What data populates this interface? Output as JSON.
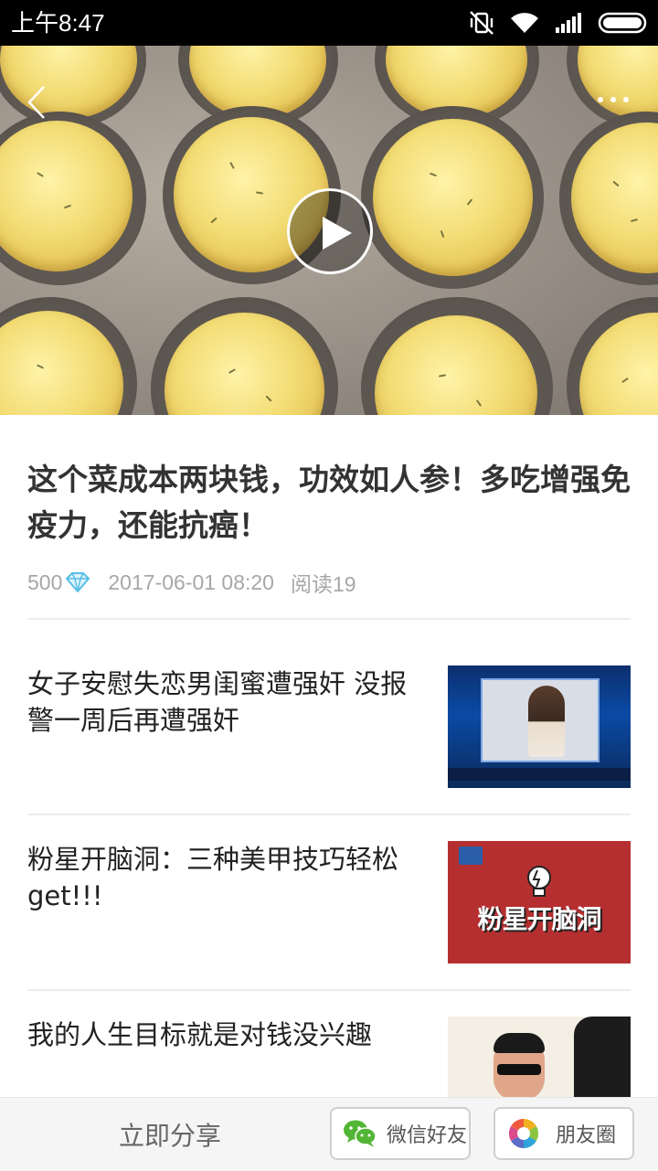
{
  "status_bar": {
    "time": "上午8:47"
  },
  "video": {
    "accent_color": "#ffffff"
  },
  "article": {
    "title": "这个菜成本两块钱，功效如人参！多吃增强免疫力，还能抗癌！",
    "coins": "500",
    "date": "2017-06-01 08:20",
    "reads": "阅读19"
  },
  "related": [
    {
      "title": "女子安慰失恋男闺蜜遭强奸 没报警一周后再遭强奸"
    },
    {
      "title": "粉星开脑洞：三种美甲技巧轻松get!!!",
      "thumb_text": "粉星开脑洞"
    },
    {
      "title": "我的人生目标就是对钱没兴趣"
    }
  ],
  "share_bar": {
    "label": "立即分享",
    "wechat_label": "微信好友",
    "moments_label": "朋友圈"
  }
}
